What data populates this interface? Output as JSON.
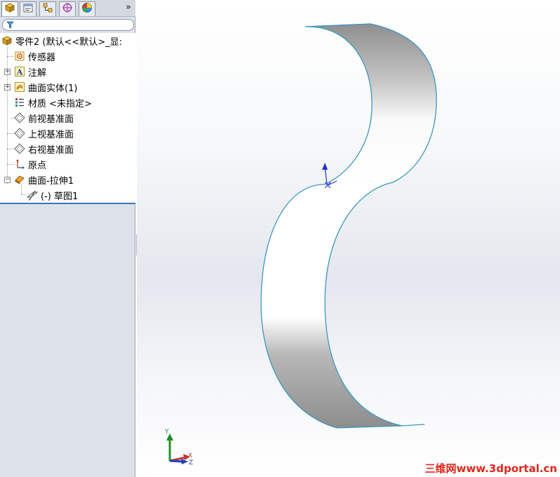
{
  "tabs": [
    {
      "name": "feature-manager",
      "icon": "feature-tree-icon",
      "active": true
    },
    {
      "name": "property-manager",
      "icon": "property-manager-icon",
      "active": false
    },
    {
      "name": "configuration-manager",
      "icon": "configuration-icon",
      "active": false
    },
    {
      "name": "dimxpert-manager",
      "icon": "dimxpert-icon",
      "active": false
    },
    {
      "name": "display-manager",
      "icon": "display-manager-icon",
      "active": false
    }
  ],
  "more_tabs_label": "»",
  "filter": {
    "icon": "filter-icon",
    "value": ""
  },
  "tree": {
    "root": "零件2  (默认<<默认>_显:",
    "items": [
      {
        "label": "传感器",
        "icon": "sensor-icon"
      },
      {
        "label": "注解",
        "icon": "annotation-icon"
      },
      {
        "label": "曲面实体(1)",
        "icon": "surface-bodies-icon"
      },
      {
        "label": "材质 <未指定>",
        "icon": "material-icon"
      },
      {
        "label": "前视基准面",
        "icon": "plane-icon"
      },
      {
        "label": "上视基准面",
        "icon": "plane-icon"
      },
      {
        "label": "右视基准面",
        "icon": "plane-icon"
      },
      {
        "label": "原点",
        "icon": "origin-icon"
      },
      {
        "label": "曲面-拉伸1",
        "icon": "surface-extrude-icon"
      },
      {
        "label": "(-) 草图1",
        "icon": "sketch-icon"
      }
    ]
  },
  "triad": {
    "x": "X",
    "y": "Y",
    "z": "Z"
  },
  "watermark": "三维网www.3dportal.cn",
  "colors": {
    "edge": "#3a97c4",
    "surface_dark": "#9a9a9a",
    "watermark": "#e1251b",
    "tree_separator": "#3b73b9"
  }
}
